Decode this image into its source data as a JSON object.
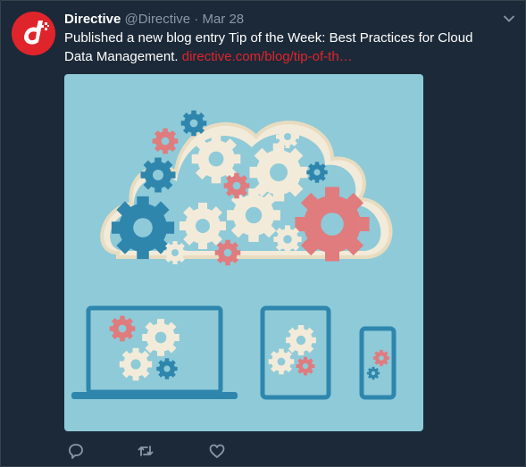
{
  "tweet": {
    "display_name": "Directive",
    "handle": "@Directive",
    "separator": "·",
    "date": "Mar 28",
    "text": "Published a new blog entry Tip of the Week: Best Practices for Cloud Data Management.",
    "link": "directive.com/blog/tip-of-th…"
  },
  "icons": {
    "avatar": "directive-logo-icon",
    "menu": "chevron-down-icon",
    "reply": "reply-icon",
    "retweet": "retweet-icon",
    "like": "heart-icon"
  },
  "colors": {
    "background": "#1c2938",
    "brand": "#e0242b",
    "muted": "#8899a6",
    "image_bg": "#8fcad8",
    "cloud": "#f3ebd9",
    "gear_blue": "#2e86ad",
    "gear_pink": "#e07b7e"
  }
}
